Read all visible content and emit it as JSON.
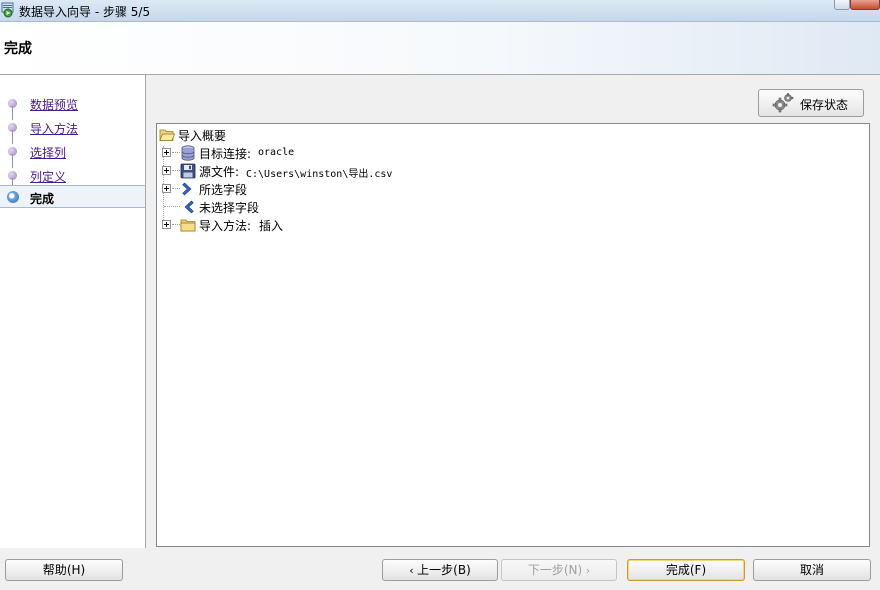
{
  "window": {
    "title": "数据导入向导 - 步骤 5/5"
  },
  "header": {
    "title": "完成"
  },
  "sidebar": {
    "steps": [
      {
        "label": "数据预览",
        "state": "visited"
      },
      {
        "label": "导入方法",
        "state": "visited"
      },
      {
        "label": "选择列",
        "state": "visited"
      },
      {
        "label": "列定义",
        "state": "visited"
      },
      {
        "label": "完成",
        "state": "current"
      }
    ]
  },
  "toolbar": {
    "save_state_label": "保存状态"
  },
  "summary": {
    "root_label": "导入概要",
    "items": {
      "target_connection": {
        "label": "目标连接:",
        "value": "oracle"
      },
      "source_file": {
        "label": "源文件:",
        "value": "C:\\Users\\winston\\导出.csv"
      },
      "selected_fields": {
        "label": "所选字段"
      },
      "unselected_fields": {
        "label": "未选择字段"
      },
      "import_method": {
        "label": "导入方法:",
        "value": "插入"
      }
    }
  },
  "footer": {
    "help_label": "帮助",
    "help_key": "(H)",
    "back_label": "上一步",
    "back_key": "(B)",
    "next_label": "下一步",
    "next_key": "(N)",
    "finish_label": "完成",
    "finish_key": "(F)",
    "cancel_label": "取消"
  },
  "icons": {
    "tree_root": "folder-open-icon",
    "target_connection": "database-icon",
    "source_file": "disk-icon",
    "selected_fields": "chevron-right-icon",
    "unselected_fields": "chevron-left-icon",
    "import_method": "folder-icon"
  },
  "colors": {
    "link_visited": "#4a1a8e",
    "selection_border": "#a7bad3",
    "focus_border": "#c99b2b"
  }
}
